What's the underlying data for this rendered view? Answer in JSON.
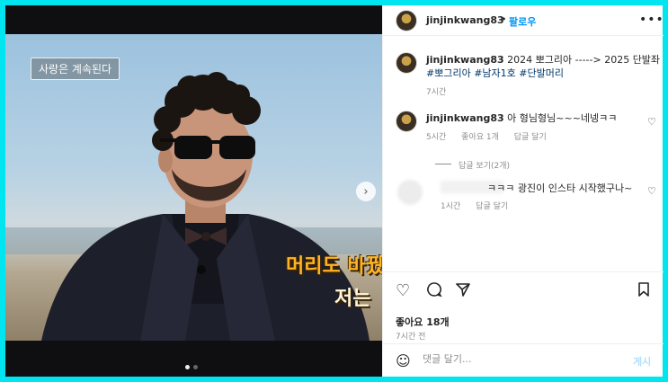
{
  "media": {
    "top_small_text": "",
    "caption_box": "사랑은 계속된다",
    "subtitle_line1": "머리도 바꿨",
    "subtitle_line2": "저는",
    "next_icon": "chevron-right-icon",
    "dots_count": 2,
    "active_dot": 1
  },
  "header": {
    "username": "jinjinkwang83",
    "separator": "•",
    "follow_label": "팔로우",
    "more_icon": "more-horizontal-icon",
    "more_glyph": "•••"
  },
  "post": {
    "username": "jinjinkwang83",
    "caption": "2024 뽀그리아 -----> 2025 단발좌",
    "hashtags": "#뽀그리아 #남자1호 #단발머리",
    "time": "7시간"
  },
  "comments": [
    {
      "username": "jinjinkwang83",
      "text": "아 형님형님~~~네넹ㅋㅋ",
      "time": "5시간",
      "likes": "좋아요 1개",
      "reply": "답글 달기",
      "view_replies": "답글 보기(2개)"
    },
    {
      "username": "",
      "text": "ㅋㅋㅋ 광진이 인스타 시작했구나~",
      "time": "1시간",
      "reply": "답글 달기"
    }
  ],
  "actions": {
    "like_icon": "heart-icon",
    "comment_icon": "comment-icon",
    "share_icon": "send-icon",
    "save_icon": "bookmark-icon",
    "likes_label": "좋아요 18개",
    "ago_label": "7시간 전"
  },
  "comment_box": {
    "emoji_icon": "smiley-icon",
    "placeholder": "댓글 달기...",
    "post_label": "게시"
  }
}
